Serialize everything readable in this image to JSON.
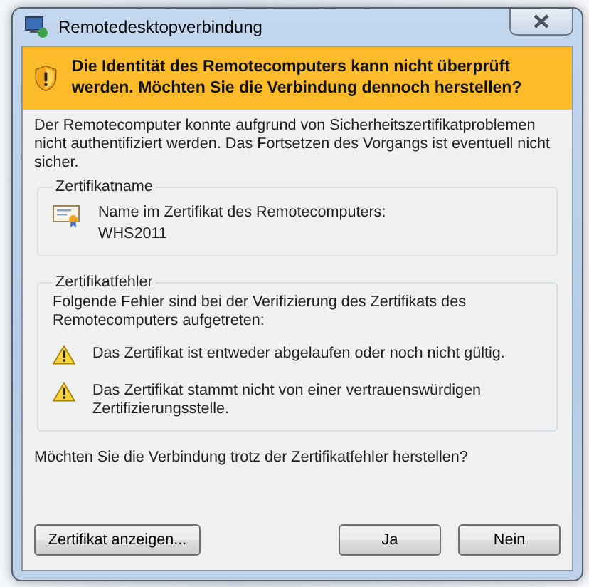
{
  "window": {
    "title": "Remotedesktopverbindung"
  },
  "banner": {
    "heading": "Die Identität des Remotecomputers kann nicht überprüft werden. Möchten Sie die Verbindung dennoch herstellen?"
  },
  "intro": "Der Remotecomputer konnte aufgrund von Sicherheitszertifikatproblemen nicht authentifiziert werden. Das Fortsetzen des Vorgangs ist eventuell nicht sicher.",
  "certificate_name": {
    "legend": "Zertifikatname",
    "label": "Name im Zertifikat des Remotecomputers:",
    "value": "WHS2011"
  },
  "certificate_errors": {
    "legend": "Zertifikatfehler",
    "description": "Folgende Fehler sind bei der Verifizierung des Zertifikats des Remotecomputers aufgetreten:",
    "errors": [
      {
        "text": "Das Zertifikat ist entweder abgelaufen oder noch nicht gültig."
      },
      {
        "text": "Das Zertifikat stammt nicht von einer vertrauenswürdigen Zertifizierungsstelle."
      }
    ]
  },
  "question": "Möchten Sie die Verbindung trotz der Zertifikatfehler herstellen?",
  "buttons": [
    {
      "label": "Zertifikat anzeigen...",
      "kind": "secondary"
    },
    {
      "label": "Ja",
      "kind": "primary"
    },
    {
      "label": "Nein",
      "kind": "primary"
    }
  ]
}
